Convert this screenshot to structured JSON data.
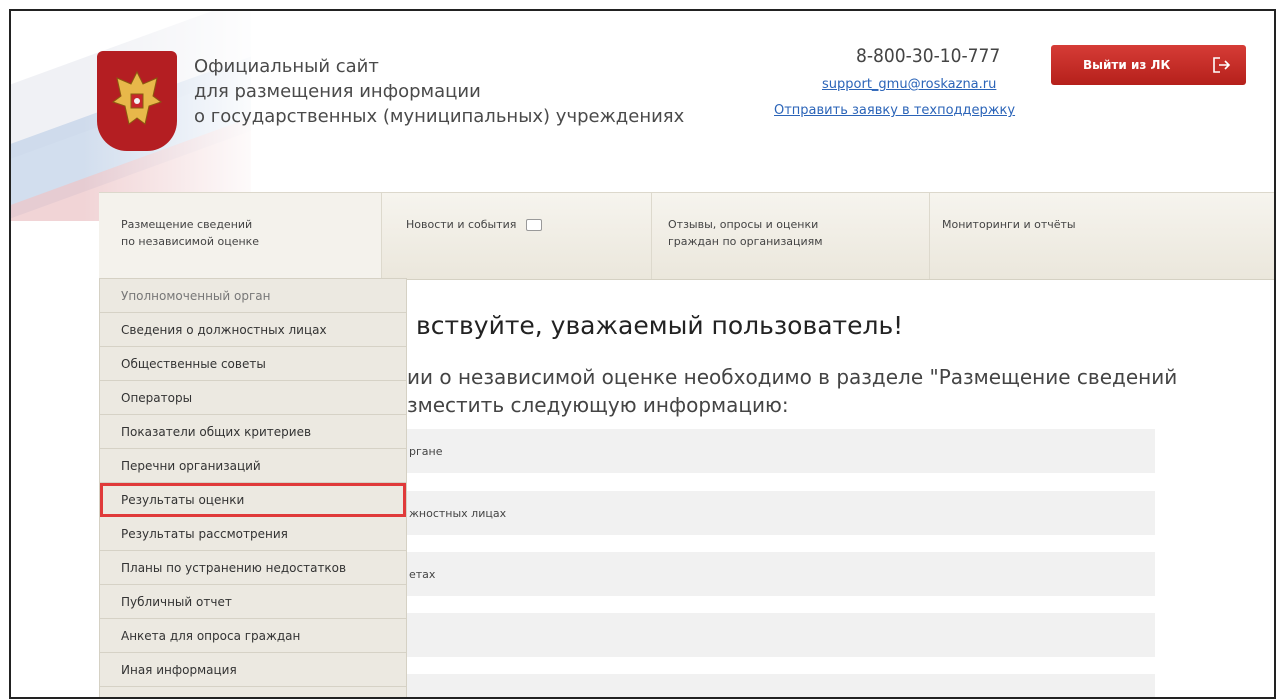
{
  "header": {
    "title_lines": [
      "Официальный сайт",
      "для размещения информации",
      "о государственных (муниципальных) учреждениях"
    ],
    "phone": "8-800-30-10-777",
    "email": "support_gmu@roskazna.ru",
    "support_link": "Отправить заявку в техподдержку",
    "logout_label": "Выйти из ЛК"
  },
  "nav": {
    "items": [
      {
        "line1": "Размещение сведений",
        "line2": "по независимой оценке"
      },
      {
        "line1": "Новости и события",
        "line2": ""
      },
      {
        "line1": "Отзывы, опросы и оценки",
        "line2": "граждан по организациям"
      },
      {
        "line1": "Мониторинги и отчёты",
        "line2": ""
      }
    ]
  },
  "dropdown": {
    "items": [
      "Уполномоченный орган",
      "Сведения о должностных лицах",
      "Общественные советы",
      "Операторы",
      "Показатели общих критериев",
      "Перечни организаций",
      "Результаты оценки",
      "Результаты рассмотрения",
      "Планы по устранению недостатков",
      "Публичный отчет",
      "Анкета для опроса граждан",
      "Иная информация"
    ],
    "highlighted_index": 6
  },
  "main": {
    "greeting": "вствуйте, уважаемый пользователь!",
    "lead_line1": "ии о независимой оценке необходимо в разделе \"Размещение сведений",
    "lead_line2": "зместить следующую информацию:",
    "rows": [
      "ргане",
      "жностных лицах",
      "етах",
      ""
    ]
  },
  "colors": {
    "accent_red": "#c62a24",
    "link_blue": "#2b64b8",
    "highlight_outline": "#e03a3a"
  }
}
